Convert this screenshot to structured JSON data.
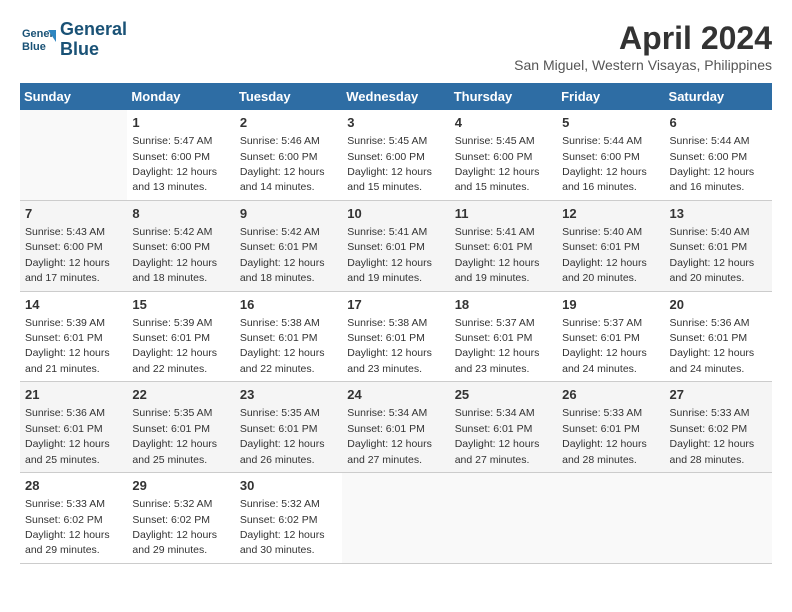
{
  "logo": {
    "line1": "General",
    "line2": "Blue"
  },
  "title": "April 2024",
  "location": "San Miguel, Western Visayas, Philippines",
  "days_of_week": [
    "Sunday",
    "Monday",
    "Tuesday",
    "Wednesday",
    "Thursday",
    "Friday",
    "Saturday"
  ],
  "weeks": [
    [
      {
        "day": "",
        "info": ""
      },
      {
        "day": "1",
        "info": "Sunrise: 5:47 AM\nSunset: 6:00 PM\nDaylight: 12 hours\nand 13 minutes."
      },
      {
        "day": "2",
        "info": "Sunrise: 5:46 AM\nSunset: 6:00 PM\nDaylight: 12 hours\nand 14 minutes."
      },
      {
        "day": "3",
        "info": "Sunrise: 5:45 AM\nSunset: 6:00 PM\nDaylight: 12 hours\nand 15 minutes."
      },
      {
        "day": "4",
        "info": "Sunrise: 5:45 AM\nSunset: 6:00 PM\nDaylight: 12 hours\nand 15 minutes."
      },
      {
        "day": "5",
        "info": "Sunrise: 5:44 AM\nSunset: 6:00 PM\nDaylight: 12 hours\nand 16 minutes."
      },
      {
        "day": "6",
        "info": "Sunrise: 5:44 AM\nSunset: 6:00 PM\nDaylight: 12 hours\nand 16 minutes."
      }
    ],
    [
      {
        "day": "7",
        "info": "Sunrise: 5:43 AM\nSunset: 6:00 PM\nDaylight: 12 hours\nand 17 minutes."
      },
      {
        "day": "8",
        "info": "Sunrise: 5:42 AM\nSunset: 6:00 PM\nDaylight: 12 hours\nand 18 minutes."
      },
      {
        "day": "9",
        "info": "Sunrise: 5:42 AM\nSunset: 6:01 PM\nDaylight: 12 hours\nand 18 minutes."
      },
      {
        "day": "10",
        "info": "Sunrise: 5:41 AM\nSunset: 6:01 PM\nDaylight: 12 hours\nand 19 minutes."
      },
      {
        "day": "11",
        "info": "Sunrise: 5:41 AM\nSunset: 6:01 PM\nDaylight: 12 hours\nand 19 minutes."
      },
      {
        "day": "12",
        "info": "Sunrise: 5:40 AM\nSunset: 6:01 PM\nDaylight: 12 hours\nand 20 minutes."
      },
      {
        "day": "13",
        "info": "Sunrise: 5:40 AM\nSunset: 6:01 PM\nDaylight: 12 hours\nand 20 minutes."
      }
    ],
    [
      {
        "day": "14",
        "info": "Sunrise: 5:39 AM\nSunset: 6:01 PM\nDaylight: 12 hours\nand 21 minutes."
      },
      {
        "day": "15",
        "info": "Sunrise: 5:39 AM\nSunset: 6:01 PM\nDaylight: 12 hours\nand 22 minutes."
      },
      {
        "day": "16",
        "info": "Sunrise: 5:38 AM\nSunset: 6:01 PM\nDaylight: 12 hours\nand 22 minutes."
      },
      {
        "day": "17",
        "info": "Sunrise: 5:38 AM\nSunset: 6:01 PM\nDaylight: 12 hours\nand 23 minutes."
      },
      {
        "day": "18",
        "info": "Sunrise: 5:37 AM\nSunset: 6:01 PM\nDaylight: 12 hours\nand 23 minutes."
      },
      {
        "day": "19",
        "info": "Sunrise: 5:37 AM\nSunset: 6:01 PM\nDaylight: 12 hours\nand 24 minutes."
      },
      {
        "day": "20",
        "info": "Sunrise: 5:36 AM\nSunset: 6:01 PM\nDaylight: 12 hours\nand 24 minutes."
      }
    ],
    [
      {
        "day": "21",
        "info": "Sunrise: 5:36 AM\nSunset: 6:01 PM\nDaylight: 12 hours\nand 25 minutes."
      },
      {
        "day": "22",
        "info": "Sunrise: 5:35 AM\nSunset: 6:01 PM\nDaylight: 12 hours\nand 25 minutes."
      },
      {
        "day": "23",
        "info": "Sunrise: 5:35 AM\nSunset: 6:01 PM\nDaylight: 12 hours\nand 26 minutes."
      },
      {
        "day": "24",
        "info": "Sunrise: 5:34 AM\nSunset: 6:01 PM\nDaylight: 12 hours\nand 27 minutes."
      },
      {
        "day": "25",
        "info": "Sunrise: 5:34 AM\nSunset: 6:01 PM\nDaylight: 12 hours\nand 27 minutes."
      },
      {
        "day": "26",
        "info": "Sunrise: 5:33 AM\nSunset: 6:01 PM\nDaylight: 12 hours\nand 28 minutes."
      },
      {
        "day": "27",
        "info": "Sunrise: 5:33 AM\nSunset: 6:02 PM\nDaylight: 12 hours\nand 28 minutes."
      }
    ],
    [
      {
        "day": "28",
        "info": "Sunrise: 5:33 AM\nSunset: 6:02 PM\nDaylight: 12 hours\nand 29 minutes."
      },
      {
        "day": "29",
        "info": "Sunrise: 5:32 AM\nSunset: 6:02 PM\nDaylight: 12 hours\nand 29 minutes."
      },
      {
        "day": "30",
        "info": "Sunrise: 5:32 AM\nSunset: 6:02 PM\nDaylight: 12 hours\nand 30 minutes."
      },
      {
        "day": "",
        "info": ""
      },
      {
        "day": "",
        "info": ""
      },
      {
        "day": "",
        "info": ""
      },
      {
        "day": "",
        "info": ""
      }
    ]
  ]
}
